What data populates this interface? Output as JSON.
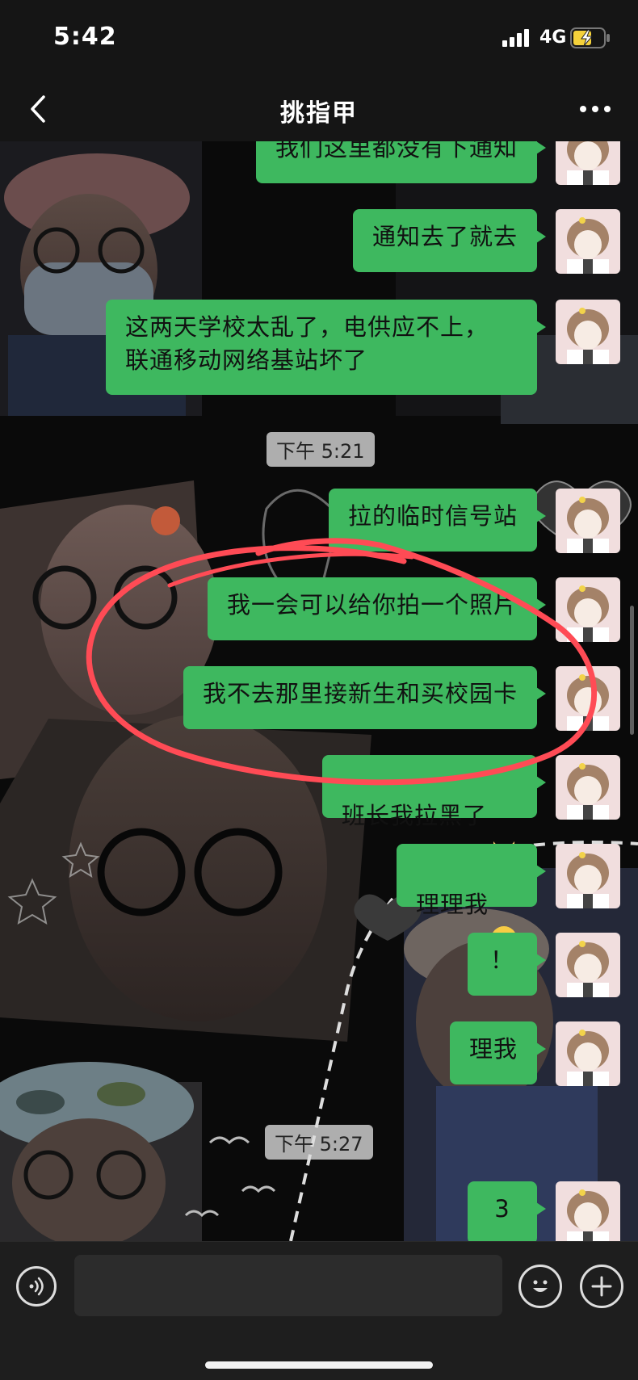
{
  "status_bar": {
    "time": "5:42",
    "network": "4G"
  },
  "nav": {
    "title": "挑指甲"
  },
  "messages": [
    {
      "text": "我们这里都没有下通知"
    },
    {
      "text": "通知去了就去"
    },
    {
      "text": "这两天学校太乱了，电供应不上，\n联通移动网络基站坏了"
    },
    {
      "text": "拉的临时信号站"
    },
    {
      "text": "我一会可以给你拍一个照片"
    },
    {
      "text": "我不去那里接新生和买校园卡"
    },
    {
      "text": "班长我拉黑了"
    },
    {
      "text": "理理我"
    },
    {
      "text": "！"
    },
    {
      "text": "理我"
    },
    {
      "text": "3"
    }
  ],
  "time_separators": [
    "下午 5:21",
    "下午 5:27"
  ],
  "input": {
    "placeholder": ""
  },
  "colors": {
    "bubble": "#3eb85f",
    "annotation": "#ff4b55",
    "bar": "#151515"
  },
  "icons": [
    "back-icon",
    "more-icon",
    "voice-icon",
    "emoji-icon",
    "plus-icon",
    "signal-icon",
    "battery-icon"
  ]
}
